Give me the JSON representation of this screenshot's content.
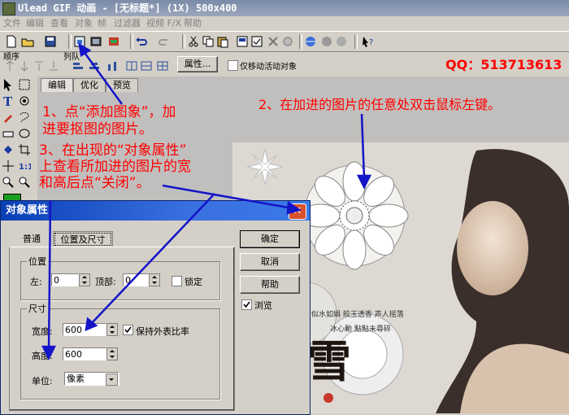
{
  "window": {
    "title": "Ulead GIF 动画 - [无标题*] (1X) 500x400"
  },
  "menu": [
    "文件",
    "编辑",
    "查看",
    "对象",
    "帧",
    "过滤器",
    "视频 F/X",
    "帮助"
  ],
  "toolbar2": {
    "order_label": "顺序",
    "arrange_label": "列队",
    "properties_button": "属性...",
    "move_active_only_label": "仅移动活动对象"
  },
  "qq": {
    "label": "QQ：513713613"
  },
  "tabs": [
    "编辑",
    "优化",
    "预览"
  ],
  "annotations": {
    "a1_line1": "1、点“添加图象”，加",
    "a1_line2": "进要抠图的图片。",
    "a2": "2、在加进的图片的任意处双击鼠标左键。",
    "a3_line1": "3、在出现的“对象属性”",
    "a3_line2": "上查看所加进的图片的宽",
    "a3_line3": "和高后点“关闭”。"
  },
  "dialog": {
    "title": "对象属性",
    "tabs": [
      "普通",
      "位置及尺寸"
    ],
    "position_group": "位置",
    "left_label": "左:",
    "left_value": "0",
    "top_label": "顶部:",
    "top_value": "0",
    "lock_label": "锁定",
    "size_group": "尺寸",
    "width_label": "宽度:",
    "width_value": "600",
    "height_label": "高度:",
    "height_value": "600",
    "keep_ratio_label": "保持外表比率",
    "unit_label": "单位:",
    "unit_value": "像素",
    "ok_button": "确定",
    "cancel_button": "取消",
    "help_button": "帮助",
    "browse_label": "浏览"
  },
  "image_text": {
    "poem_line1": "似水如娟  皎玉透香  声人摇落",
    "poem_line2": "冰心動  點點未尋碎",
    "calligraphy": "雪"
  }
}
